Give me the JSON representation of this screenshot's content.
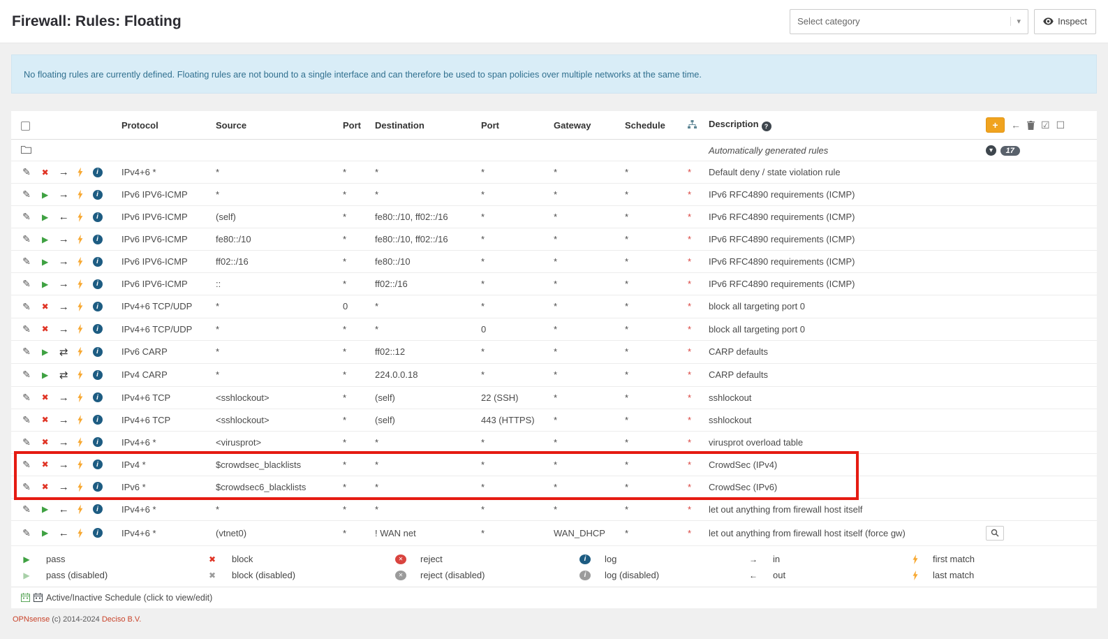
{
  "header": {
    "title": "Firewall: Rules: Floating",
    "category_placeholder": "Select category",
    "inspect_label": "Inspect"
  },
  "alert": {
    "text": "No floating rules are currently defined. Floating rules are not bound to a single interface and can therefore be used to span policies over multiple networks at the same time."
  },
  "icons": {
    "pencil": "✎",
    "block": "✖",
    "pass": "▶",
    "dir_in": "→",
    "dir_out": "←",
    "dir_both": "⇄",
    "info": "i",
    "help": "?",
    "plus": "+",
    "arrow_left": "←",
    "check_square": "☑",
    "square": "☐",
    "caret_down": "▾",
    "chevron_down": "▾",
    "reject_x": "✕"
  },
  "colors": {
    "accent_orange": "#f0a31f",
    "pass_green": "#3fa142",
    "block_red": "#e03425",
    "bolt_orange": "#f7a832",
    "info_navy": "#1d5c82",
    "alert_bg": "#d9edf7",
    "alert_text": "#31708f",
    "highlight_red": "#e51b12",
    "schedule_red": "#d9443f",
    "badge_gray": "#59616b",
    "link_color": "#c9432a"
  },
  "table": {
    "columns": {
      "protocol": "Protocol",
      "source": "Source",
      "src_port": "Port",
      "destination": "Destination",
      "dst_port": "Port",
      "gateway": "Gateway",
      "schedule": "Schedule",
      "description": "Description"
    },
    "group_row": {
      "label": "Automatically generated rules",
      "badge_count": "17"
    },
    "rows": [
      {
        "action": "block",
        "dir": "in",
        "proto": "IPv4+6 *",
        "source": "*",
        "sport": "*",
        "dest": "*",
        "dport": "*",
        "gw": "*",
        "sched": "*",
        "mark": "*",
        "desc": "Default deny / state violation rule"
      },
      {
        "action": "pass",
        "dir": "in",
        "proto": "IPv6 IPV6-ICMP",
        "source": "*",
        "sport": "*",
        "dest": "*",
        "dport": "*",
        "gw": "*",
        "sched": "*",
        "mark": "*",
        "desc": "IPv6 RFC4890 requirements (ICMP)"
      },
      {
        "action": "pass",
        "dir": "out",
        "proto": "IPv6 IPV6-ICMP",
        "source": "(self)",
        "sport": "*",
        "dest": "fe80::/10, ff02::/16",
        "dport": "*",
        "gw": "*",
        "sched": "*",
        "mark": "*",
        "desc": "IPv6 RFC4890 requirements (ICMP)"
      },
      {
        "action": "pass",
        "dir": "in",
        "proto": "IPv6 IPV6-ICMP",
        "source": "fe80::/10",
        "sport": "*",
        "dest": "fe80::/10, ff02::/16",
        "dport": "*",
        "gw": "*",
        "sched": "*",
        "mark": "*",
        "desc": "IPv6 RFC4890 requirements (ICMP)"
      },
      {
        "action": "pass",
        "dir": "in",
        "proto": "IPv6 IPV6-ICMP",
        "source": "ff02::/16",
        "sport": "*",
        "dest": "fe80::/10",
        "dport": "*",
        "gw": "*",
        "sched": "*",
        "mark": "*",
        "desc": "IPv6 RFC4890 requirements (ICMP)"
      },
      {
        "action": "pass",
        "dir": "in",
        "proto": "IPv6 IPV6-ICMP",
        "source": "::",
        "sport": "*",
        "dest": "ff02::/16",
        "dport": "*",
        "gw": "*",
        "sched": "*",
        "mark": "*",
        "desc": "IPv6 RFC4890 requirements (ICMP)"
      },
      {
        "action": "block",
        "dir": "in",
        "proto": "IPv4+6 TCP/UDP",
        "source": "*",
        "sport": "0",
        "dest": "*",
        "dport": "*",
        "gw": "*",
        "sched": "*",
        "mark": "*",
        "desc": "block all targeting port 0"
      },
      {
        "action": "block",
        "dir": "in",
        "proto": "IPv4+6 TCP/UDP",
        "source": "*",
        "sport": "*",
        "dest": "*",
        "dport": "0",
        "gw": "*",
        "sched": "*",
        "mark": "*",
        "desc": "block all targeting port 0"
      },
      {
        "action": "pass",
        "dir": "both",
        "proto": "IPv6 CARP",
        "source": "*",
        "sport": "*",
        "dest": "ff02::12",
        "dport": "*",
        "gw": "*",
        "sched": "*",
        "mark": "*",
        "desc": "CARP defaults"
      },
      {
        "action": "pass",
        "dir": "both",
        "proto": "IPv4 CARP",
        "source": "*",
        "sport": "*",
        "dest": "224.0.0.18",
        "dport": "*",
        "gw": "*",
        "sched": "*",
        "mark": "*",
        "desc": "CARP defaults"
      },
      {
        "action": "block",
        "dir": "in",
        "proto": "IPv4+6 TCP",
        "source": "<sshlockout>",
        "sport": "*",
        "dest": "(self)",
        "dport": "22 (SSH)",
        "gw": "*",
        "sched": "*",
        "mark": "*",
        "desc": "sshlockout"
      },
      {
        "action": "block",
        "dir": "in",
        "proto": "IPv4+6 TCP",
        "source": "<sshlockout>",
        "sport": "*",
        "dest": "(self)",
        "dport": "443 (HTTPS)",
        "gw": "*",
        "sched": "*",
        "mark": "*",
        "desc": "sshlockout"
      },
      {
        "action": "block",
        "dir": "in",
        "proto": "IPv4+6 *",
        "source": "<virusprot>",
        "sport": "*",
        "dest": "*",
        "dport": "*",
        "gw": "*",
        "sched": "*",
        "mark": "*",
        "desc": "virusprot overload table"
      },
      {
        "action": "block",
        "dir": "in",
        "proto": "IPv4 *",
        "source": "$crowdsec_blacklists",
        "sport": "*",
        "dest": "*",
        "dport": "*",
        "gw": "*",
        "sched": "*",
        "mark": "*",
        "desc": "CrowdSec (IPv4)",
        "highlight": true
      },
      {
        "action": "block",
        "dir": "in",
        "proto": "IPv6 *",
        "source": "$crowdsec6_blacklists",
        "sport": "*",
        "dest": "*",
        "dport": "*",
        "gw": "*",
        "sched": "*",
        "mark": "*",
        "desc": "CrowdSec (IPv6)",
        "highlight": true
      },
      {
        "action": "pass",
        "dir": "out",
        "proto": "IPv4+6 *",
        "source": "*",
        "sport": "*",
        "dest": "*",
        "dport": "*",
        "gw": "*",
        "sched": "*",
        "mark": "*",
        "desc": "let out anything from firewall host itself"
      },
      {
        "action": "pass",
        "dir": "out",
        "proto": "IPv4+6 *",
        "source": "(vtnet0)",
        "sport": "*",
        "dest": "! WAN net",
        "dport": "*",
        "gw": "WAN_DHCP",
        "sched": "*",
        "mark": "*",
        "desc": "let out anything from firewall host itself (force gw)",
        "search": true
      }
    ]
  },
  "legend": {
    "items": [
      {
        "icon": "pass",
        "label": "pass"
      },
      {
        "icon": "block",
        "label": "block"
      },
      {
        "icon": "reject",
        "label": "reject"
      },
      {
        "icon": "log",
        "label": "log"
      },
      {
        "icon": "in",
        "label": "in"
      },
      {
        "icon": "first",
        "label": "first match"
      },
      {
        "icon": "pass-disabled",
        "label": "pass (disabled)"
      },
      {
        "icon": "block-disabled",
        "label": "block (disabled)"
      },
      {
        "icon": "reject-disabled",
        "label": "reject (disabled)"
      },
      {
        "icon": "log-disabled",
        "label": "log (disabled)"
      },
      {
        "icon": "out",
        "label": "out"
      },
      {
        "icon": "last",
        "label": "last match"
      }
    ],
    "schedule_note": "Active/Inactive Schedule (click to view/edit)"
  },
  "footer": {
    "brand": "OPNsense",
    "copyright": "(c) 2014-2024",
    "company": "Deciso B.V."
  }
}
